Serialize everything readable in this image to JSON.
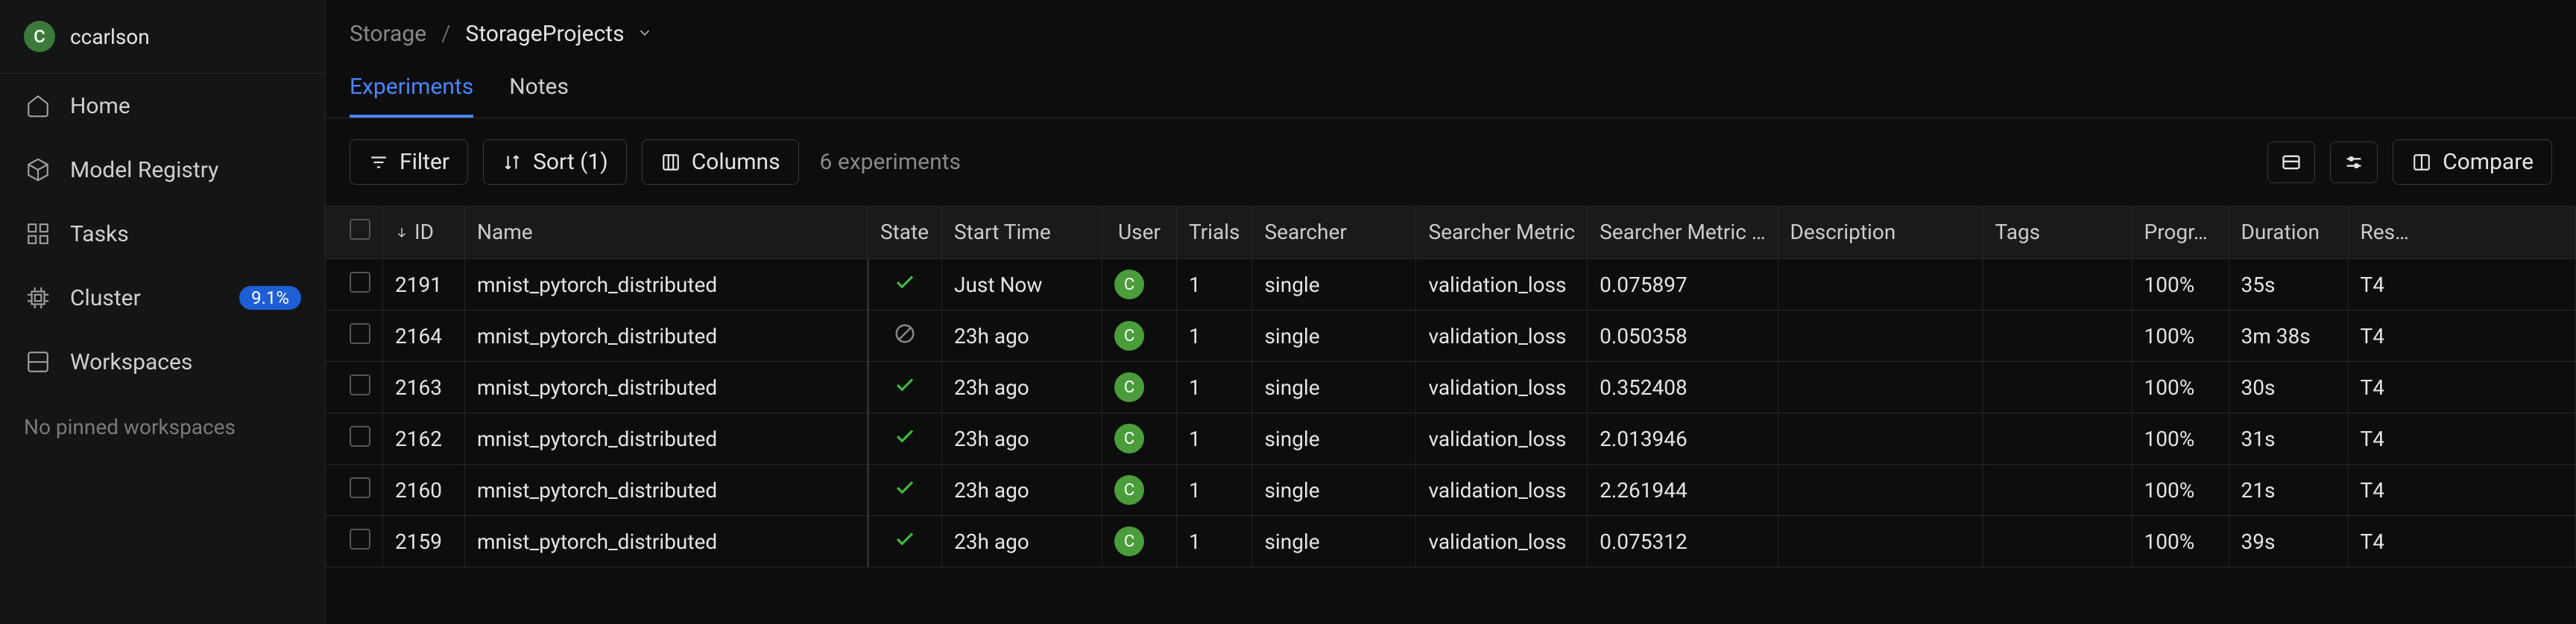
{
  "user": {
    "avatar_letter": "C",
    "name": "ccarlson"
  },
  "sidebar": {
    "items": [
      {
        "label": "Home"
      },
      {
        "label": "Model Registry"
      },
      {
        "label": "Tasks"
      },
      {
        "label": "Cluster",
        "badge": "9.1%"
      },
      {
        "label": "Workspaces"
      }
    ],
    "pinned_empty": "No pinned workspaces"
  },
  "breadcrumb": {
    "root": "Storage",
    "sep": "/",
    "current": "StorageProjects"
  },
  "tabs": {
    "experiments": "Experiments",
    "notes": "Notes"
  },
  "toolbar": {
    "filter": "Filter",
    "sort": "Sort (1)",
    "columns": "Columns",
    "count": "6 experiments",
    "compare": "Compare"
  },
  "columns": {
    "id": "ID",
    "name": "Name",
    "state": "State",
    "start": "Start Time",
    "user": "User",
    "trials": "Trials",
    "searcher": "Searcher",
    "metric": "Searcher Metric",
    "metricval": "Searcher Metric …",
    "desc": "Description",
    "tags": "Tags",
    "progress": "Progr…",
    "duration": "Duration",
    "resource": "Res…"
  },
  "rows": [
    {
      "id": "2191",
      "name": "mnist_pytorch_distributed",
      "state": "complete",
      "start": "Just Now",
      "user": "C",
      "trials": "1",
      "searcher": "single",
      "metric": "validation_loss",
      "metricval": "0.075897",
      "desc": "",
      "tags": "",
      "progress": "100%",
      "duration": "35s",
      "resource": "T4"
    },
    {
      "id": "2164",
      "name": "mnist_pytorch_distributed",
      "state": "cancelled",
      "start": "23h ago",
      "user": "C",
      "trials": "1",
      "searcher": "single",
      "metric": "validation_loss",
      "metricval": "0.050358",
      "desc": "",
      "tags": "",
      "progress": "100%",
      "duration": "3m 38s",
      "resource": "T4"
    },
    {
      "id": "2163",
      "name": "mnist_pytorch_distributed",
      "state": "complete",
      "start": "23h ago",
      "user": "C",
      "trials": "1",
      "searcher": "single",
      "metric": "validation_loss",
      "metricval": "0.352408",
      "desc": "",
      "tags": "",
      "progress": "100%",
      "duration": "30s",
      "resource": "T4"
    },
    {
      "id": "2162",
      "name": "mnist_pytorch_distributed",
      "state": "complete",
      "start": "23h ago",
      "user": "C",
      "trials": "1",
      "searcher": "single",
      "metric": "validation_loss",
      "metricval": "2.013946",
      "desc": "",
      "tags": "",
      "progress": "100%",
      "duration": "31s",
      "resource": "T4"
    },
    {
      "id": "2160",
      "name": "mnist_pytorch_distributed",
      "state": "complete",
      "start": "23h ago",
      "user": "C",
      "trials": "1",
      "searcher": "single",
      "metric": "validation_loss",
      "metricval": "2.261944",
      "desc": "",
      "tags": "",
      "progress": "100%",
      "duration": "21s",
      "resource": "T4"
    },
    {
      "id": "2159",
      "name": "mnist_pytorch_distributed",
      "state": "complete",
      "start": "23h ago",
      "user": "C",
      "trials": "1",
      "searcher": "single",
      "metric": "validation_loss",
      "metricval": "0.075312",
      "desc": "",
      "tags": "",
      "progress": "100%",
      "duration": "39s",
      "resource": "T4"
    }
  ]
}
